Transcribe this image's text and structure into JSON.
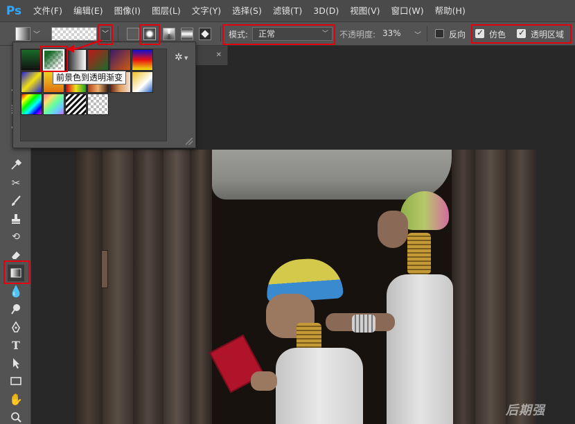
{
  "app": {
    "logo": "Ps"
  },
  "menu": [
    "文件(F)",
    "编辑(E)",
    "图像(I)",
    "图层(L)",
    "文字(Y)",
    "选择(S)",
    "滤镜(T)",
    "3D(D)",
    "视图(V)",
    "窗口(W)",
    "帮助(H)"
  ],
  "options": {
    "mode_label": "模式:",
    "mode_value": "正常",
    "opacity_label": "不透明度:",
    "opacity_value": "33%",
    "reverse_label": "反向",
    "reverse_checked": false,
    "dither_label": "仿色",
    "dither_checked": true,
    "transparency_label": "透明区域",
    "transparency_checked": true,
    "gradient_types": [
      "linear",
      "radial",
      "angle",
      "reflected",
      "diamond"
    ],
    "selected_gradient_type": "radial"
  },
  "picker": {
    "tooltip": "前景色到透明渐变",
    "selected_index": 1,
    "gear_icon": "gear-icon"
  },
  "toolbar": {
    "selected_tool": "gradient-tool"
  },
  "colors": {
    "highlight": "#e3000f",
    "ps_blue": "#31a8ff"
  },
  "watermark": "后期强"
}
